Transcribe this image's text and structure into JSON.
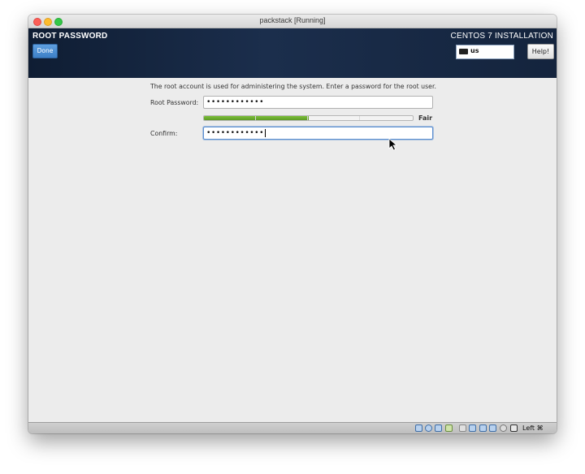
{
  "window": {
    "title": "packstack [Running]"
  },
  "header": {
    "page_title": "ROOT PASSWORD",
    "done_label": "Done",
    "installer_title": "CENTOS 7 INSTALLATION",
    "keyboard_layout": "us",
    "help_label": "Help!"
  },
  "form": {
    "description": "The root account is used for administering the system.  Enter a password for the root user.",
    "root_password_label": "Root Password:",
    "root_password_value": "••••••••••••",
    "strength_label": "Fair",
    "strength_fraction": 0.5,
    "confirm_label": "Confirm:",
    "confirm_value": "••••••••••••"
  },
  "statusbar": {
    "icons": [
      "hdd-icon",
      "optical-drive-icon",
      "usb-icon",
      "shared-folders-icon",
      "display-icon",
      "network-icon",
      "recording-icon",
      "cpu-icon",
      "mouse-integration-icon",
      "download-icon"
    ],
    "host_key": "Left ⌘"
  },
  "colors": {
    "header_bg": "#15263f",
    "done_button": "#4a8ad4",
    "meter_fill": "#6aa82f",
    "content_bg": "#ececec"
  }
}
